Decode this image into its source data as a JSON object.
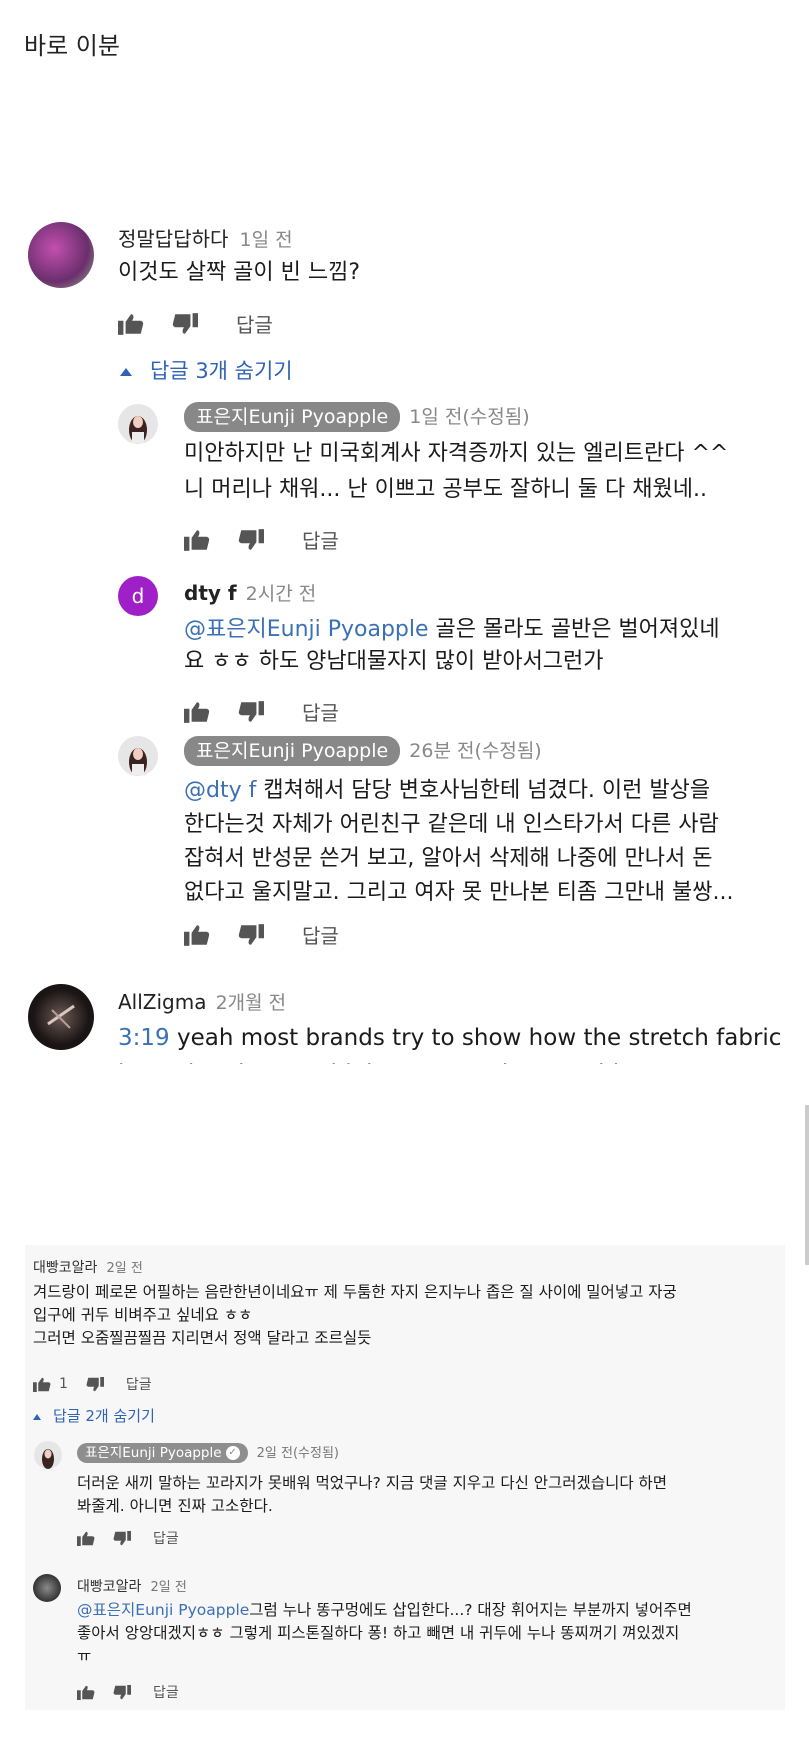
{
  "page_title": "바로 이분",
  "section1": {
    "c1": {
      "author": "정말답답하다",
      "time": "1일 전",
      "text": "이것도 살짝 골이 빈 느낌?",
      "reply_label": "답글",
      "toggle_label": "답글 3개 숨기기"
    },
    "r1": {
      "author": "표은지Eunji Pyoapple",
      "time": "1일 전(수정됨)",
      "lines": [
        "미안하지만 난 미국회계사 자격증까지 있는 엘리트란다 ^^",
        "니 머리나 채워... 난 이쁘고 공부도 잘하니 둘 다 채웠네.."
      ],
      "reply_label": "답글"
    },
    "r2": {
      "author": "dty f",
      "avatar_letter": "d",
      "time": "2시간 전",
      "mention": "@표은지Eunji Pyoapple",
      "line1_rest": " 골은 몰라도 골반은 벌어져있네",
      "line2": "요 ㅎㅎ 하도 양남대물자지 많이 받아서그런가",
      "reply_label": "답글"
    },
    "r3": {
      "author": "표은지Eunji Pyoapple",
      "time": "26분 전(수정됨)",
      "mention": "@dty f",
      "line1_rest": " 캡쳐해서 담당 변호사님한테 넘겼다. 이런 발상을",
      "lines": [
        "한다는것 자체가 어린친구 같은데 내 인스타가서 다른 사람",
        "잡혀서 반성문 쓴거 보고, 알아서 삭제해 나중에 만나서 돈",
        "없다고 울지말고. 그리고 여자 못 만나본 티좀 그만내 불쌍..."
      ],
      "reply_label": "답글"
    },
    "c2": {
      "author": "AllZigma",
      "time": "2개월 전",
      "timestamp_link": "3:19",
      "line1_rest": " yeah most brands try to show how the stretch fabric",
      "line2": "is, and make you think everyone is wearable"
    }
  },
  "section2": {
    "c1": {
      "author": "대빵코알라",
      "time": "2일 전",
      "lines": [
        "겨드랑이 페로몬 어필하는 음란한년이네요ㅠ 제 두툼한 자지 은지누나 좁은 질 사이에 밀어넣고 자궁",
        "입구에 귀두 비벼주고 싶네요 ㅎㅎ",
        "그러면 오줌찔끔찔끔 지리면서 정액 달라고 조르실듯"
      ],
      "like_count": "1",
      "reply_label": "답글",
      "toggle_label": "답글 2개 숨기기"
    },
    "r1": {
      "author": "표은지Eunji Pyoapple",
      "time": "2일 전(수정됨)",
      "lines": [
        "더러운 새끼 말하는 꼬라지가 못배워 먹었구나?  지금 댓글 지우고 다신 안그러겠습니다 하면",
        "봐줄게. 아니면 진짜 고소한다."
      ],
      "reply_label": "답글"
    },
    "r2": {
      "author": "대빵코알라",
      "time": "2일 전",
      "mention": "@표은지Eunji Pyoapple",
      "line1_rest": "그럼 누나 똥구멍에도 삽입한다...?  대장 휘어지는 부분까지 넣어주면",
      "lines": [
        "좋아서 앙앙대겠지ㅎㅎ 그렇게 피스톤질하다 퐁! 하고 빼면 내 귀두에 누나 똥찌꺼기 껴있겠지",
        "ㅠ"
      ],
      "reply_label": "답글"
    }
  },
  "colors": {
    "link": "#3b6fb6",
    "toggle": "#3063b7",
    "chip_bg": "#888888",
    "avatar_d": "#a020c8"
  }
}
